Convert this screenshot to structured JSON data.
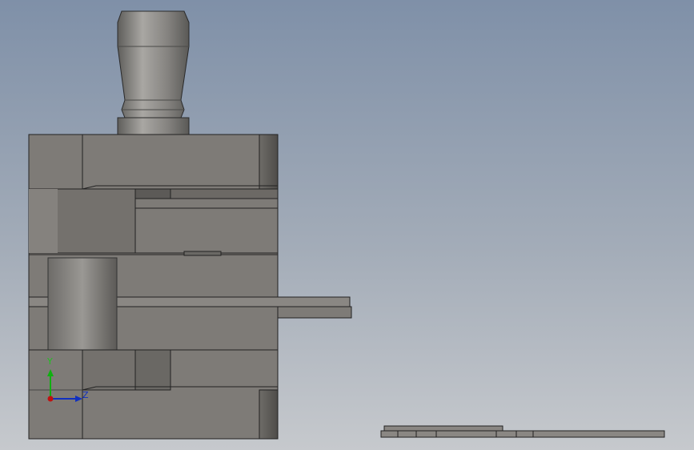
{
  "viewport": {
    "background_top": "#7f90a8",
    "background_bottom": "#c6c9cd",
    "part_color": "#7e7b77",
    "part_dark": "#55534f",
    "part_light": "#9a9894"
  },
  "triad": {
    "y_label": "Y",
    "z_label": "Z",
    "y_color": "#10b010",
    "z_color": "#1030c0",
    "x_color": "#c01010"
  }
}
